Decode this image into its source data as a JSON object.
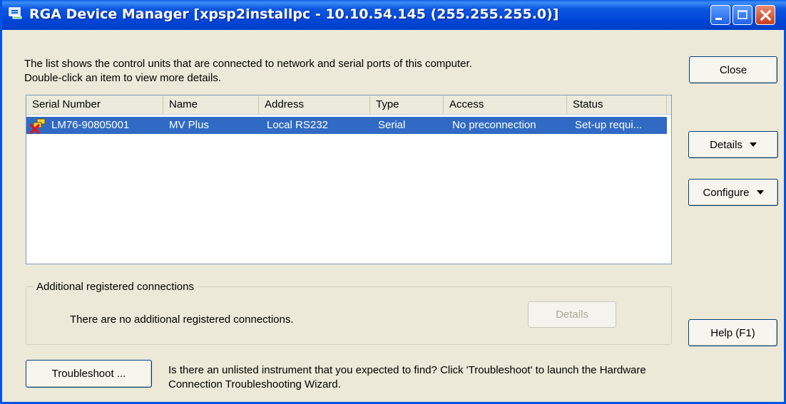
{
  "window": {
    "title": "RGA Device Manager [xpsp2installpc - 10.10.54.145 (255.255.255.0)]"
  },
  "description": {
    "line1": "The list shows the control units that are connected to network and serial ports of this computer.",
    "line2": "Double-click an item to view more details."
  },
  "buttons": {
    "close": "Close",
    "details": "Details",
    "configure": "Configure",
    "help": "Help (F1)",
    "troubleshoot": "Troubleshoot ...",
    "group_details": "Details"
  },
  "table": {
    "columns": [
      "Serial Number",
      "Name",
      "Address",
      "Type",
      "Access",
      "Status"
    ],
    "rows": [
      {
        "serial": "LM76-90805001",
        "name": "MV Plus",
        "address": "Local RS232",
        "type": "Serial",
        "access": "No preconnection",
        "status": "Set-up requi...",
        "selected": true,
        "icon": "device-error-icon"
      }
    ]
  },
  "additional": {
    "label": "Additional registered connections",
    "message": "There are no additional registered connections."
  },
  "troubleshoot_text": {
    "line1": "Is there an unlisted instrument that you expected to find?  Click 'Troubleshoot' to launch the Hardware",
    "line2": "Connection Troubleshooting Wizard."
  },
  "colors": {
    "titlebar": "#0045d6",
    "selection": "#316ac5",
    "window_bg": "#ece9d8"
  }
}
